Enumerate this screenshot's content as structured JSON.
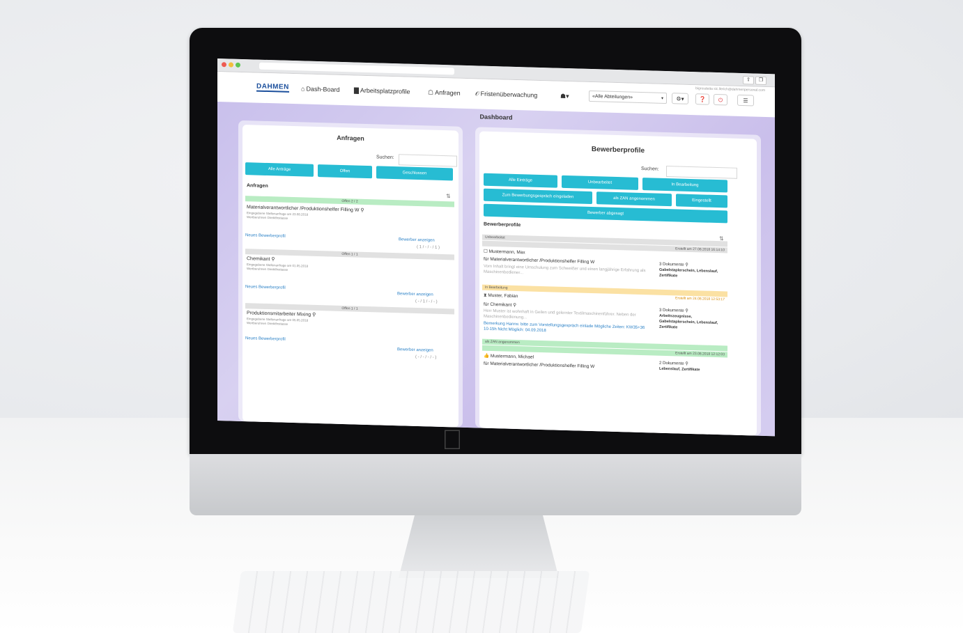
{
  "browser": {
    "icons": [
      "share-icon",
      "tabs-icon"
    ]
  },
  "topnav": {
    "logo": "DAHMEN",
    "user_email": "bigrosdetta sic.llerich@dahmenpersonal.com",
    "items": [
      {
        "label": "Dash-Board",
        "icon": "home-icon",
        "glyph": "⌂"
      },
      {
        "label": "Arbeitsplatzprofile",
        "icon": "folder-icon",
        "glyph": "▇"
      },
      {
        "label": "Anfragen",
        "icon": "inbox-icon",
        "glyph": "☖"
      },
      {
        "label": "Fristenüberwachung",
        "icon": "link-icon",
        "glyph": "𝒪"
      }
    ],
    "user_menu_glyph": "☗▾",
    "department_select": "«Alle Abteilungen»",
    "settings_glyph": "⚙▾",
    "help_glyph": "❓",
    "logout_glyph": "⏻",
    "menu_glyph": "☰"
  },
  "dashboard": {
    "title": "Dashboard"
  },
  "anfragen": {
    "title": "Anfragen",
    "search_label": "Suchen:",
    "filters": [
      "Alle Anträge",
      "Offen",
      "Geschlossen"
    ],
    "section_title": "Anfragen",
    "sort_glyph": "⇅",
    "requests": [
      {
        "status": "Offen 2 / 2",
        "title": "Materialverantwortlicher /Produktionshelfer Filling W",
        "meta1": "Eingegebene Stellenanfrage am 23.08.2018",
        "meta2": "Wertberuhnen Direktfirstiasse",
        "new_profile": "Neues Bewerberprofil",
        "show_applicants": "Bewerber anzeigen",
        "counts": "( 1 / - / - / 1 )"
      },
      {
        "status": "Offen 1 / 1",
        "title": "Chemikant",
        "meta1": "Eingegebene Stellenanfrage am 01.05.2018",
        "meta2": "Wertberuhnen Direktfirstiasse",
        "new_profile": "Neues Bewerberprofil",
        "show_applicants": "Bewerber anzeigen",
        "counts": "( - / 1 / - / - )"
      },
      {
        "status": "Offen 1 / 1",
        "title": "Produktionsmitarbeiter Mixing",
        "meta1": "Eingegebene Stellenanfrage am 05.05.2018",
        "meta2": "Wertberuhnen Direktfirstiasse",
        "new_profile": "Neues Bewerberprofil",
        "show_applicants": "Bewerber anzeigen",
        "counts": "( - / - / - / - )"
      }
    ]
  },
  "bewerber": {
    "title": "Bewerberprofile",
    "search_label": "Suchen:",
    "filters_row1": [
      "Alle Einträge",
      "Unbearbeitet",
      "In Bearbeitung"
    ],
    "filters_row2": [
      "Zum Bewerbungsgespräch eingeladen",
      "als ZAN angenommen",
      "Eingestellt"
    ],
    "filters_row3": [
      "Bewerber abgesagt"
    ],
    "section_title": "Bewerberprofile",
    "sort_glyph": "⇅",
    "profiles": [
      {
        "status": "Unbearbeitet",
        "created": "Erstellt am 27.08.2018 16:14:10",
        "name": "Mustermann, Max",
        "position": "für Materialverantwortlicher /Produktionshelfer Filling W",
        "note": "Vom Inhalt bringt eine Umschulung zum Schweißer und einen langjährige Erfahrung als Maschinenbediener...",
        "docs_count": "3 Dokumente",
        "docs_list": "Gabelstaplerschein, Lebenslauf, Zertifikate"
      },
      {
        "status": "In Bearbeitung",
        "created": "Erstellt am 24.08.2018 12:53:17",
        "name": "Muster, Fabian",
        "position": "für Chemikant",
        "note": "Herr Muster ist wohnhaft in Geilen und gelernter Textilmaschinenführer. Neben der Maschinenbedienung...",
        "remark": "Bemerkung Hanns: bitte zum Vorstellungsgespräch einlade Mögliche Zeiten: KW35+36 10-15h Nicht Möglich: 04.09.2018",
        "docs_count": "3 Dokumente",
        "docs_list": "Arbeitszeugnisse, Gabelstaplerschein, Lebenslauf, Zertifikate"
      },
      {
        "status": "als ZAN angenommen",
        "created": "Erstellt am 23.08.2018 12:12:03",
        "name": "Mustermann, Michael",
        "position": "für Materialverantwortlicher /Produktionshelfer Filling W",
        "docs_count": "2 Dokumente",
        "docs_list": "Lebenslauf, Zertifikate"
      }
    ]
  },
  "colors": {
    "accent": "#27bcd3",
    "status_green": "#b9ecc3",
    "status_grey": "#e1e1e1",
    "status_yellow": "#fbe1a3",
    "link": "#2a80c6",
    "logo": "#1b4f9c",
    "background": "#cfc6ee"
  }
}
